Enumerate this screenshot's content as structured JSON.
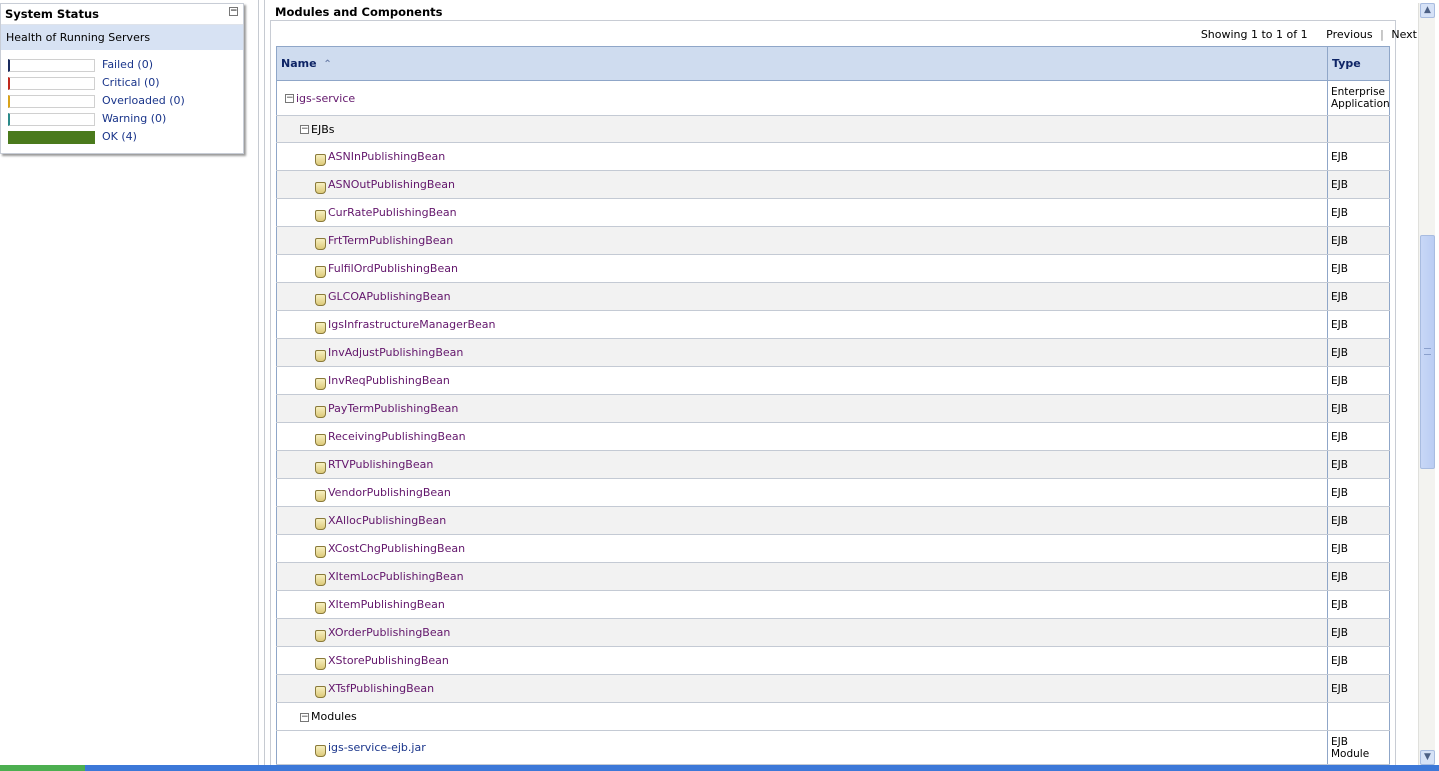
{
  "system_status": {
    "title": "System Status",
    "subtitle": "Health of Running Servers",
    "rows": [
      {
        "label": "Failed (0)",
        "color": "#1a2b5e",
        "fill": 0
      },
      {
        "label": "Critical (0)",
        "color": "#c0281c",
        "fill": 0
      },
      {
        "label": "Overloaded (0)",
        "color": "#d9a31a",
        "fill": 0
      },
      {
        "label": "Warning (0)",
        "color": "#2a8a8a",
        "fill": 0
      },
      {
        "label": "OK (4)",
        "color": "#4a7a1c",
        "fill": 1
      }
    ]
  },
  "main": {
    "title": "Modules and Components",
    "pager": {
      "showing": "Showing 1 to 1 of 1",
      "previous": "Previous",
      "next": "Next"
    },
    "columns": {
      "name": "Name",
      "type": "Type"
    },
    "app": {
      "name": "igs-service",
      "type_line1": "Enterprise",
      "type_line2": "Application"
    },
    "ejbs_label": "EJBs",
    "ejbs": [
      {
        "name": "ASNInPublishingBean",
        "type": "EJB"
      },
      {
        "name": "ASNOutPublishingBean",
        "type": "EJB"
      },
      {
        "name": "CurRatePublishingBean",
        "type": "EJB"
      },
      {
        "name": "FrtTermPublishingBean",
        "type": "EJB"
      },
      {
        "name": "FulfilOrdPublishingBean",
        "type": "EJB"
      },
      {
        "name": "GLCOAPublishingBean",
        "type": "EJB"
      },
      {
        "name": "IgsInfrastructureManagerBean",
        "type": "EJB"
      },
      {
        "name": "InvAdjustPublishingBean",
        "type": "EJB"
      },
      {
        "name": "InvReqPublishingBean",
        "type": "EJB"
      },
      {
        "name": "PayTermPublishingBean",
        "type": "EJB"
      },
      {
        "name": "ReceivingPublishingBean",
        "type": "EJB"
      },
      {
        "name": "RTVPublishingBean",
        "type": "EJB"
      },
      {
        "name": "VendorPublishingBean",
        "type": "EJB"
      },
      {
        "name": "XAllocPublishingBean",
        "type": "EJB"
      },
      {
        "name": "XCostChgPublishingBean",
        "type": "EJB"
      },
      {
        "name": "XItemLocPublishingBean",
        "type": "EJB"
      },
      {
        "name": "XItemPublishingBean",
        "type": "EJB"
      },
      {
        "name": "XOrderPublishingBean",
        "type": "EJB"
      },
      {
        "name": "XStorePublishingBean",
        "type": "EJB"
      },
      {
        "name": "XTsfPublishingBean",
        "type": "EJB"
      }
    ],
    "modules_label": "Modules",
    "modules": [
      {
        "name": "igs-service-ejb.jar",
        "type_line1": "EJB",
        "type_line2": "Module"
      }
    ]
  }
}
